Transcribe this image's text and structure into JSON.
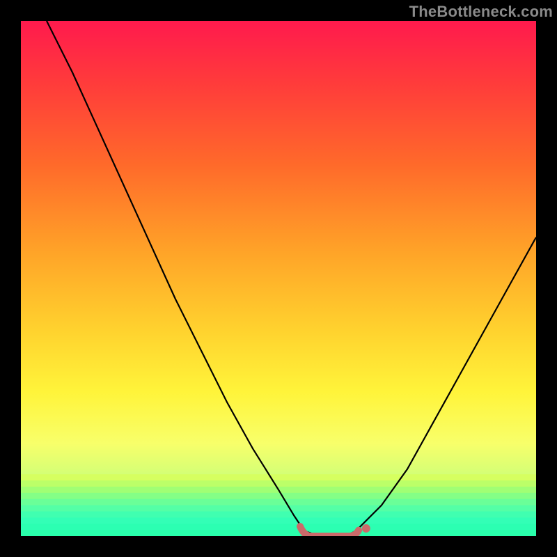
{
  "watermark": "TheBottleneck.com",
  "chart_data": {
    "type": "line",
    "title": "",
    "xlabel": "",
    "ylabel": "",
    "xlim": [
      0,
      100
    ],
    "ylim": [
      0,
      100
    ],
    "grid": false,
    "legend": false,
    "series": [
      {
        "name": "bottleneck-curve",
        "x": [
          5,
          10,
          15,
          20,
          25,
          30,
          35,
          40,
          45,
          50,
          53,
          55,
          58,
          60,
          63,
          65,
          70,
          75,
          80,
          85,
          90,
          95,
          100
        ],
        "values": [
          100,
          90,
          79,
          68,
          57,
          46,
          36,
          26,
          17,
          9,
          4,
          1,
          0,
          0,
          0,
          1,
          6,
          13,
          22,
          31,
          40,
          49,
          58
        ]
      }
    ],
    "flat_bottom_marker": {
      "color": "#cb6a6a",
      "segment_x": [
        55,
        65
      ],
      "segment_y": [
        0,
        0
      ],
      "dot_x": 67,
      "dot_y": 1.5
    },
    "background_gradient": {
      "type": "vertical-rainbow",
      "stops": [
        {
          "pos": 0.0,
          "color": "#ff1a4d"
        },
        {
          "pos": 0.12,
          "color": "#ff3b3b"
        },
        {
          "pos": 0.28,
          "color": "#ff6a2a"
        },
        {
          "pos": 0.45,
          "color": "#ffa428"
        },
        {
          "pos": 0.6,
          "color": "#ffd22e"
        },
        {
          "pos": 0.72,
          "color": "#fff43a"
        },
        {
          "pos": 0.82,
          "color": "#f8ff6a"
        },
        {
          "pos": 0.9,
          "color": "#c8ff7a"
        },
        {
          "pos": 0.95,
          "color": "#7dffb0"
        },
        {
          "pos": 1.0,
          "color": "#2aff9e"
        }
      ]
    },
    "stripes_bottom": {
      "y_start": 88,
      "count": 10,
      "colors": [
        "#d6ff60",
        "#bcff68",
        "#a0ff74",
        "#84ff86",
        "#6aff98",
        "#54ffa6",
        "#40ffb0",
        "#33ffb6",
        "#2cffb2",
        "#29ffab"
      ]
    }
  }
}
